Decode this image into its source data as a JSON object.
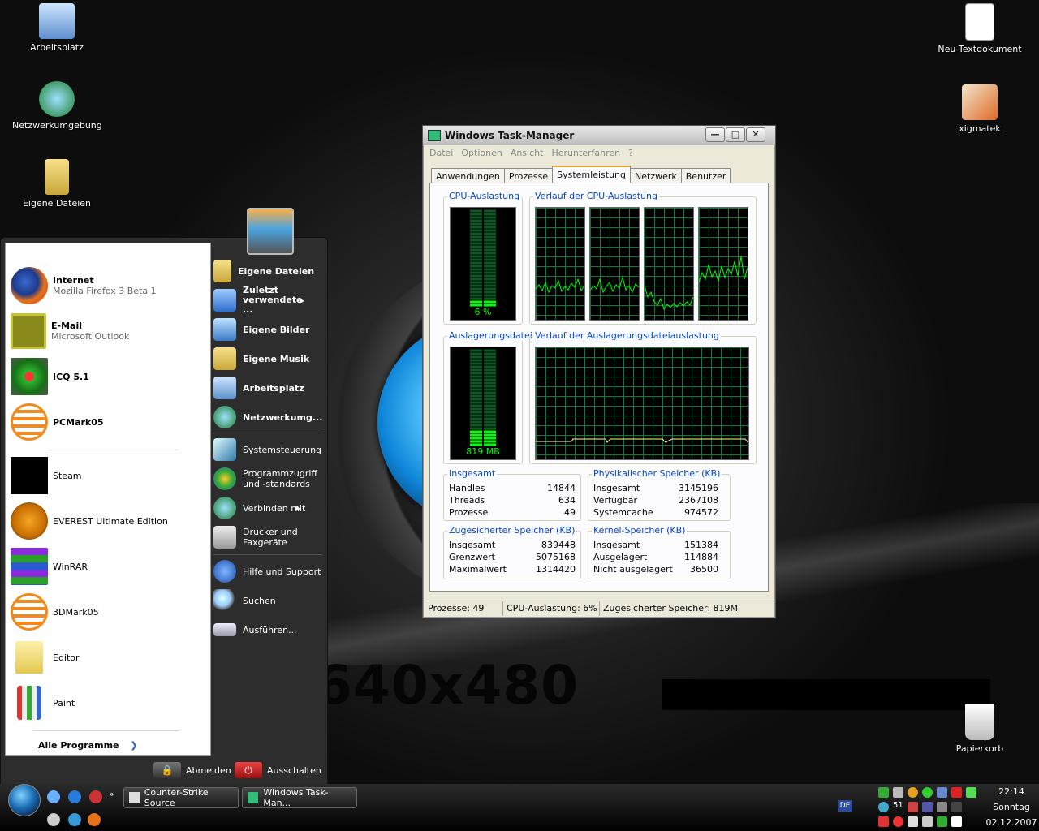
{
  "desktop": {
    "wallpaper_text": "640x480",
    "icons": {
      "arbeitsplatz": "Arbeitsplatz",
      "netzwerk": "Netzwerkumgebung",
      "eigene_dateien": "Eigene Dateien",
      "textdokument": "Neu Textdokument",
      "xigmatek": "xigmatek",
      "papierkorb": "Papierkorb"
    }
  },
  "taskmanager": {
    "title": "Windows Task-Manager",
    "menu": [
      "Datei",
      "Optionen",
      "Ansicht",
      "Herunterfahren",
      "?"
    ],
    "tabs": [
      "Anwendungen",
      "Prozesse",
      "Systemleistung",
      "Netzwerk",
      "Benutzer"
    ],
    "active_tab": "Systemleistung",
    "cpu_label": "CPU-Auslastung",
    "cpu_value": "6 %",
    "cpu_fraction": 0.06,
    "cpu_history_label": "Verlauf der CPU-Auslastung",
    "page_label": "Auslagerungsdatei",
    "page_value": "819 MB",
    "page_fraction": 0.16,
    "page_history_label": "Verlauf der Auslagerungsdateiauslastung",
    "totals": {
      "title": "Insgesamt",
      "rows": [
        {
          "label": "Handles",
          "value": "14844"
        },
        {
          "label": "Threads",
          "value": "634"
        },
        {
          "label": "Prozesse",
          "value": "49"
        }
      ]
    },
    "physical": {
      "title": "Physikalischer Speicher (KB)",
      "rows": [
        {
          "label": "Insgesamt",
          "value": "3145196"
        },
        {
          "label": "Verfügbar",
          "value": "2367108"
        },
        {
          "label": "Systemcache",
          "value": "974572"
        }
      ]
    },
    "commit": {
      "title": "Zugesicherter Speicher (KB)",
      "rows": [
        {
          "label": "Insgesamt",
          "value": "839448"
        },
        {
          "label": "Grenzwert",
          "value": "5075168"
        },
        {
          "label": "Maximalwert",
          "value": "1314420"
        }
      ]
    },
    "kernel": {
      "title": "Kernel-Speicher (KB)",
      "rows": [
        {
          "label": "Insgesamt",
          "value": "151384"
        },
        {
          "label": "Ausgelagert",
          "value": "114884"
        },
        {
          "label": "Nicht ausgelagert",
          "value": "36500"
        }
      ]
    },
    "status": {
      "processes": "Prozesse: 49",
      "cpu": "CPU-Auslastung: 6%",
      "commit": "Zugesicherter Speicher: 819M"
    }
  },
  "startmenu": {
    "pinned": [
      {
        "title": "Internet",
        "subtitle": "Mozilla Firefox 3 Beta 1"
      },
      {
        "title": "E-Mail",
        "subtitle": "Microsoft Outlook"
      },
      {
        "title": "ICQ 5.1",
        "subtitle": ""
      },
      {
        "title": "PCMark05",
        "subtitle": ""
      }
    ],
    "recent": [
      "Steam",
      "EVEREST Ultimate Edition",
      "WinRAR",
      "3DMark05",
      "Editor",
      "Paint"
    ],
    "all_programs": "Alle Programme",
    "right": {
      "eigene_dateien": "Eigene Dateien",
      "zuletzt": "Zuletzt verwendete ...",
      "eigene_bilder": "Eigene Bilder",
      "eigene_musik": "Eigene Musik",
      "arbeitsplatz": "Arbeitsplatz",
      "netzwerk": "Netzwerkumg...",
      "systemsteuerung": "Systemsteuerung",
      "programmzugriff": "Programmzugriff und -standards",
      "verbinden": "Verbinden mit",
      "drucker": "Drucker und Faxgeräte",
      "hilfe": "Hilfe und Support",
      "suchen": "Suchen",
      "ausfuehren": "Ausführen..."
    },
    "logoff": "Abmelden",
    "shutdown": "Ausschalten"
  },
  "taskbar": {
    "tasks": [
      "Counter-Strike Source",
      "Windows Task-Man..."
    ],
    "lang": "DE",
    "time": "22:14",
    "day": "Sonntag",
    "date": "02.12.2007",
    "tray_number": "51"
  },
  "colors": {
    "graph_line": "#00ff00",
    "graph_grid": "#0a7a3a",
    "group_title": "#0046d5"
  }
}
